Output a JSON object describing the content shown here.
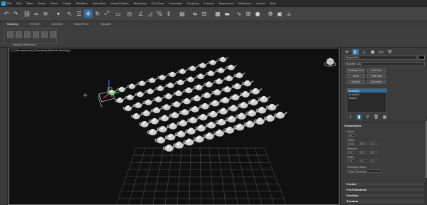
{
  "menubar": {
    "items": [
      "File",
      "Edit",
      "Tools",
      "Group",
      "Views",
      "Create",
      "Modifiers",
      "Animation",
      "Graph Editors",
      "Rendering",
      "Civil View",
      "Customize",
      "Scripting",
      "Content",
      "Megascans",
      "Substance",
      "Arnold",
      "Help"
    ]
  },
  "ribbon": {
    "tabs": [
      "Modeling",
      "Freeform",
      "Selection",
      "Object Paint",
      "Populate"
    ],
    "active_tab": "Modeling",
    "group_label": "Polygon Modeling ▾"
  },
  "viewport": {
    "label": "[+] [Perspective] [Standard] [Default Shading]",
    "grid_rows": 8,
    "grid_cols": 12
  },
  "command_panel": {
    "object_name": "Teapot001",
    "modifier_list": "Modifier List",
    "buttons": [
      "Garbage Gnd",
      "Edit Poly",
      "Array",
      "UVW Map",
      "Smooth",
      "Symmetry"
    ],
    "stack": [
      "Array001",
      "Array002",
      "Teapot"
    ],
    "stack_selected": 0,
    "rollout_array": "Parameters",
    "count_label": "Count",
    "count_value": "10",
    "offset_label": "Offset",
    "offset_values": [
      "20.0",
      "20.0",
      "0.0"
    ],
    "rotation_label": "Rotation",
    "rotation_values": [
      "0.0",
      "0.0",
      "0.0"
    ],
    "scale_label": "Scale",
    "scale_values": [
      "1.0",
      "1.0",
      "1.0"
    ],
    "transform_mode_label": "Transform Mode",
    "transform_mode_value": "Fixed Transform",
    "rollouts": [
      "Center",
      "Pre-Transform",
      "Position",
      "Random",
      "Tools"
    ]
  },
  "colors": {
    "accent": "#2e6fa0",
    "viewport_bg": "#101010",
    "panel_bg": "#3c3c3c"
  }
}
